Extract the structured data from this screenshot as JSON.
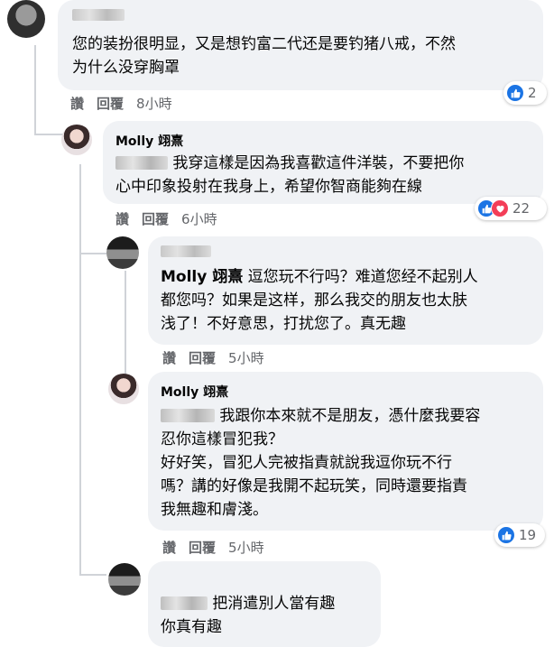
{
  "actions": {
    "like": "讚",
    "reply": "回覆"
  },
  "colors": {
    "like_blue": "#1b74e4",
    "love_red": "#f33e58",
    "bubble_bg": "#f0f2f5",
    "meta_gray": "#65676b"
  },
  "comments": [
    {
      "author": "",
      "lines": [
        "您的装扮很明显，又是想钓富二代还是要钓猪八戒，不然",
        "为什么没穿胸罩"
      ],
      "time": "8小時",
      "reaction_count": "2",
      "reaction_icons": [
        "like-icon"
      ]
    },
    {
      "author": "Molly 翊熹",
      "lines": [
        "我穿這樣是因為我喜歡這件洋裝，不要把你",
        "心中印象投射在我身上，希望你智商能夠在線"
      ],
      "time": "6小時",
      "reaction_count": "22",
      "reaction_icons": [
        "like-icon",
        "love-icon"
      ]
    },
    {
      "author": "",
      "mention": "Molly 翊熹",
      "lines": [
        "逗您玩不行吗？难道您经不起别人",
        "都您吗？如果是这样，那么我交的朋友也太肤",
        "浅了！不好意思，打扰您了。真无趣"
      ],
      "time": "5小時"
    },
    {
      "author": "Molly 翊熹",
      "lines": [
        "我跟你本來就不是朋友，憑什麼我要容",
        "忍你這樣冒犯我？",
        "好好笑，冒犯人完被指責就說我逗你玩不行",
        "嗎？講的好像是我開不起玩笑，同時還要指責",
        "我無趣和膚淺。"
      ],
      "time": "5小時",
      "reaction_count": "19",
      "reaction_icons": [
        "like-icon"
      ]
    },
    {
      "author": "",
      "lines": [
        "把消遣別人當有趣",
        "你真有趣"
      ]
    }
  ]
}
